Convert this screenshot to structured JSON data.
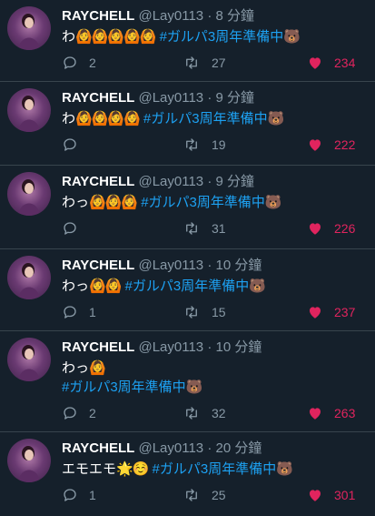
{
  "colors": {
    "background": "#15202b",
    "hashtag": "#1da1f2",
    "like": "#e0245e",
    "muted": "#8899a6"
  },
  "tweets": [
    {
      "name": "RAYCHELL",
      "handle": "@Lay0113",
      "sep": "·",
      "time": "8 分鐘",
      "text": "わ",
      "emoji": "🙆🙆🙆🙆🙆",
      "hashtag": "#ガルパ3周年準備中",
      "tag_emoji": "🐻",
      "replies": "2",
      "retweets": "27",
      "likes": "234"
    },
    {
      "name": "RAYCHELL",
      "handle": "@Lay0113",
      "sep": "·",
      "time": "9 分鐘",
      "text": "わ",
      "emoji": "🙆🙆🙆🙆",
      "hashtag": "#ガルパ3周年準備中",
      "tag_emoji": "🐻",
      "replies": "",
      "retweets": "19",
      "likes": "222"
    },
    {
      "name": "RAYCHELL",
      "handle": "@Lay0113",
      "sep": "·",
      "time": "9 分鐘",
      "text": "わっ",
      "emoji": "🙆🙆🙆",
      "hashtag": "#ガルパ3周年準備中",
      "tag_emoji": "🐻",
      "replies": "",
      "retweets": "31",
      "likes": "226"
    },
    {
      "name": "RAYCHELL",
      "handle": "@Lay0113",
      "sep": "·",
      "time": "10 分鐘",
      "text": "わっ",
      "emoji": "🙆🙆",
      "hashtag": "#ガルパ3周年準備中",
      "tag_emoji": "🐻",
      "replies": "1",
      "retweets": "15",
      "likes": "237"
    },
    {
      "name": "RAYCHELL",
      "handle": "@Lay0113",
      "sep": "·",
      "time": "10 分鐘",
      "text": "わっ",
      "emoji": "🙆",
      "hashtag": "#ガルパ3周年準備中",
      "tag_emoji": "🐻",
      "replies": "2",
      "retweets": "32",
      "likes": "263"
    },
    {
      "name": "RAYCHELL",
      "handle": "@Lay0113",
      "sep": "·",
      "time": "20 分鐘",
      "text": "エモエモ",
      "emoji": "🌟☺️",
      "hashtag": "#ガルパ3周年準備中",
      "tag_emoji": "🐻",
      "replies": "1",
      "retweets": "25",
      "likes": "301"
    }
  ]
}
